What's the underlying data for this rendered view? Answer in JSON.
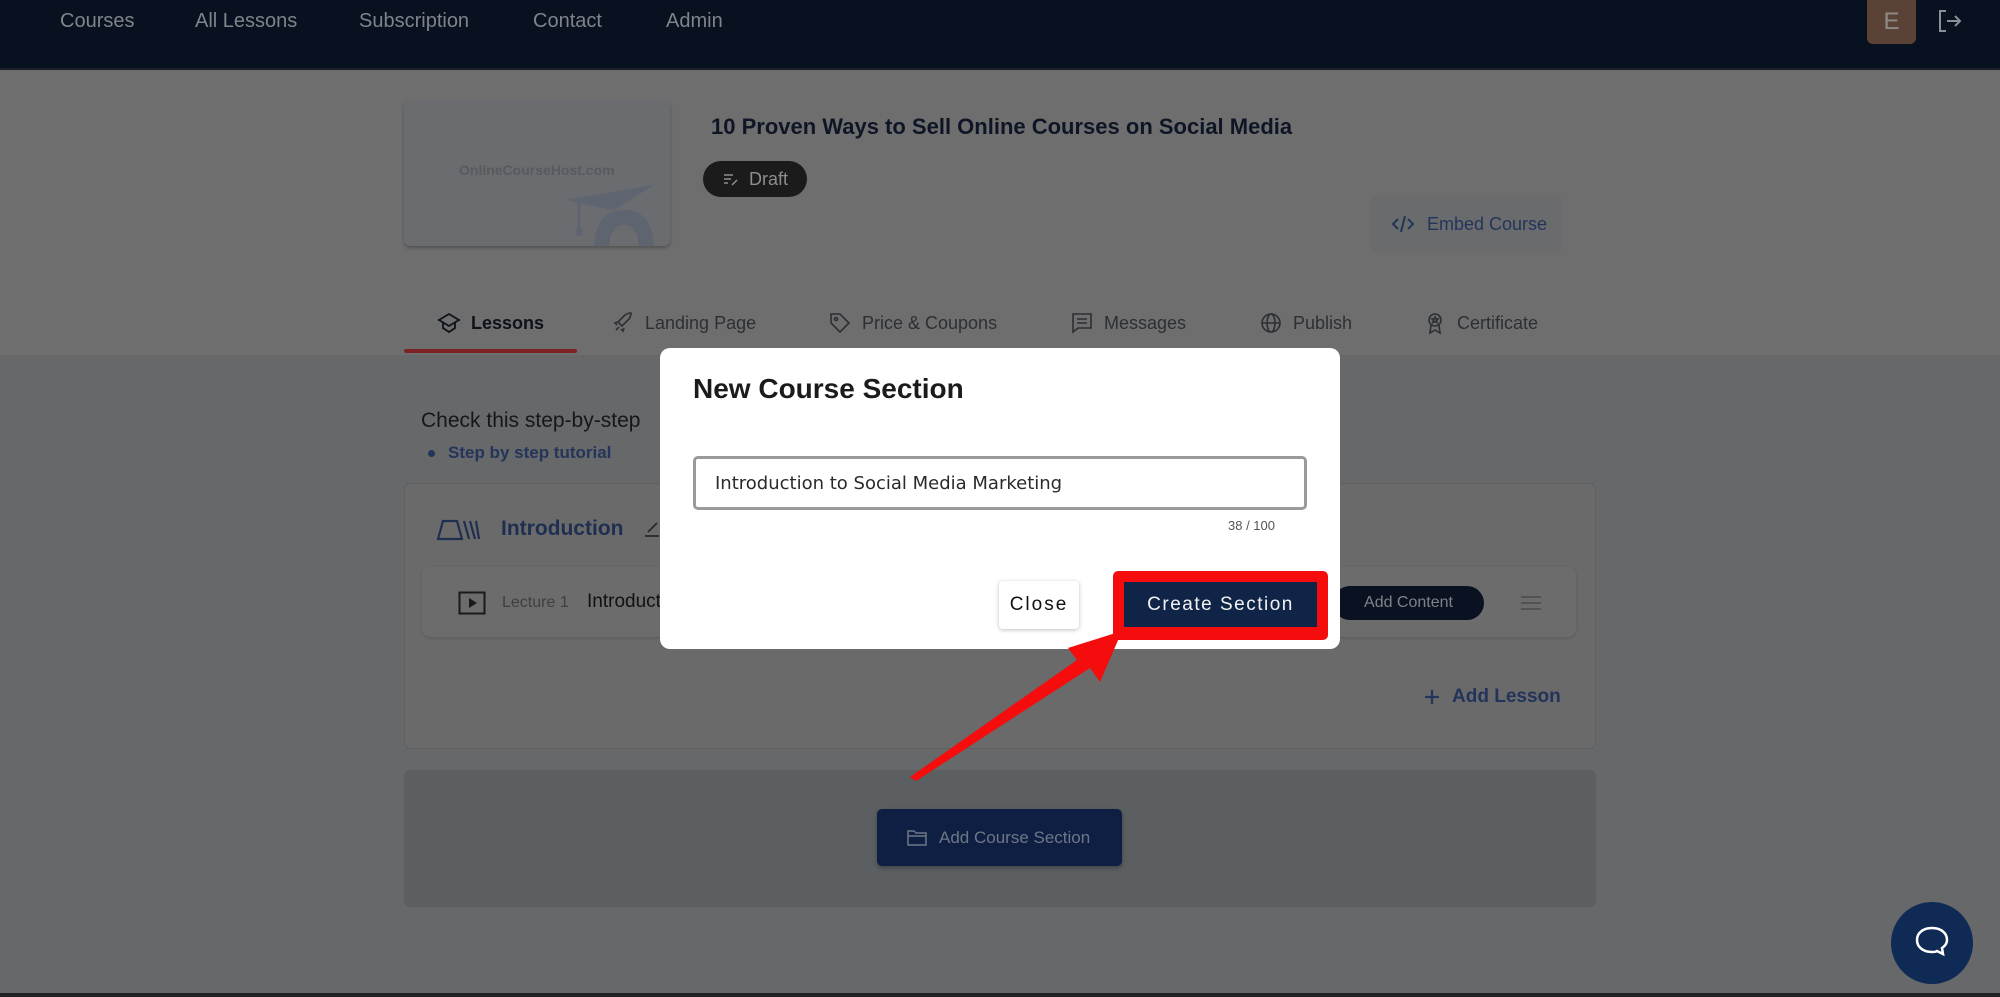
{
  "nav": {
    "items": [
      {
        "label": "Courses"
      },
      {
        "label": "All Lessons"
      },
      {
        "label": "Subscription"
      },
      {
        "label": "Contact"
      },
      {
        "label": "Admin"
      }
    ],
    "avatar_initial": "E",
    "logout_icon": "logout-icon"
  },
  "course": {
    "thumbnail_logo": "OnlineCourseHost.com",
    "title": "10 Proven Ways to Sell Online Courses on Social Media",
    "status_badge": "Draft",
    "embed_label": "Embed Course"
  },
  "tabs": [
    {
      "label": "Lessons",
      "icon": "graduation-cap-icon",
      "active": true
    },
    {
      "label": "Landing Page",
      "icon": "rocket-icon",
      "active": false
    },
    {
      "label": "Price & Coupons",
      "icon": "tag-icon",
      "active": false
    },
    {
      "label": "Messages",
      "icon": "message-icon",
      "active": false
    },
    {
      "label": "Publish",
      "icon": "globe-icon",
      "active": false
    },
    {
      "label": "Certificate",
      "icon": "award-icon",
      "active": false
    }
  ],
  "content": {
    "help_text": "Check this step-by-step",
    "tutorial_link": "Step by step tutorial",
    "section": {
      "name": "Introduction",
      "lessons": [
        {
          "number": "Lecture 1",
          "title": "Introduct",
          "action": "Add Content"
        }
      ],
      "add_lesson_label": "Add Lesson"
    },
    "add_section_label": "Add Course Section"
  },
  "modal": {
    "title": "New Course Section",
    "input_value": "Introduction to Social Media Marketing",
    "char_count": "38 / 100",
    "close_label": "Close",
    "create_label": "Create Section"
  },
  "annotation": {
    "highlight_color": "#f50c0c"
  }
}
